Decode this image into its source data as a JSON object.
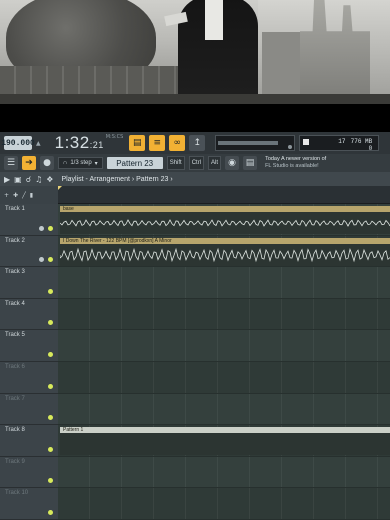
{
  "transport": {
    "tempo": "190.000",
    "time_main": "1:32",
    "time_sub": ":21",
    "time_tag": "M:S:CS",
    "cpu_val": "17",
    "mem": "776 MB",
    "voices": "0"
  },
  "toolbar2": {
    "step": "1/3 step",
    "pattern": "Pattern 23",
    "shift": "Shift",
    "ctrl": "Ctrl",
    "alt": "Alt",
    "notice_line1": "Today  A newer version of",
    "notice_line2": "FL Studio is available!"
  },
  "playlist": {
    "breadcrumb": "Playlist - Arrangement › Pattern 23 ›"
  },
  "tracks": [
    {
      "name": "Track 1",
      "clip": "base",
      "kind": "audio"
    },
    {
      "name": "Track 2",
      "clip": "I Down The River - 122 BPM [@prodkxn] A Minor",
      "kind": "audio"
    },
    {
      "name": "Track 3",
      "clip": "",
      "kind": "empty"
    },
    {
      "name": "Track 4",
      "clip": "",
      "kind": "empty"
    },
    {
      "name": "Track 5",
      "clip": "",
      "kind": "empty"
    },
    {
      "name": "Track 6",
      "clip": "",
      "kind": "empty"
    },
    {
      "name": "Track 7",
      "clip": "",
      "kind": "empty"
    },
    {
      "name": "Track 8",
      "clip": "Pattern 1",
      "kind": "pattern"
    },
    {
      "name": "Track 9",
      "clip": "",
      "kind": "empty"
    },
    {
      "name": "Track 10",
      "clip": "",
      "kind": "empty"
    }
  ],
  "colors": {
    "accent": "#f2b134",
    "audio_clip": "#b7a56c",
    "led": "#d8ea5c"
  }
}
